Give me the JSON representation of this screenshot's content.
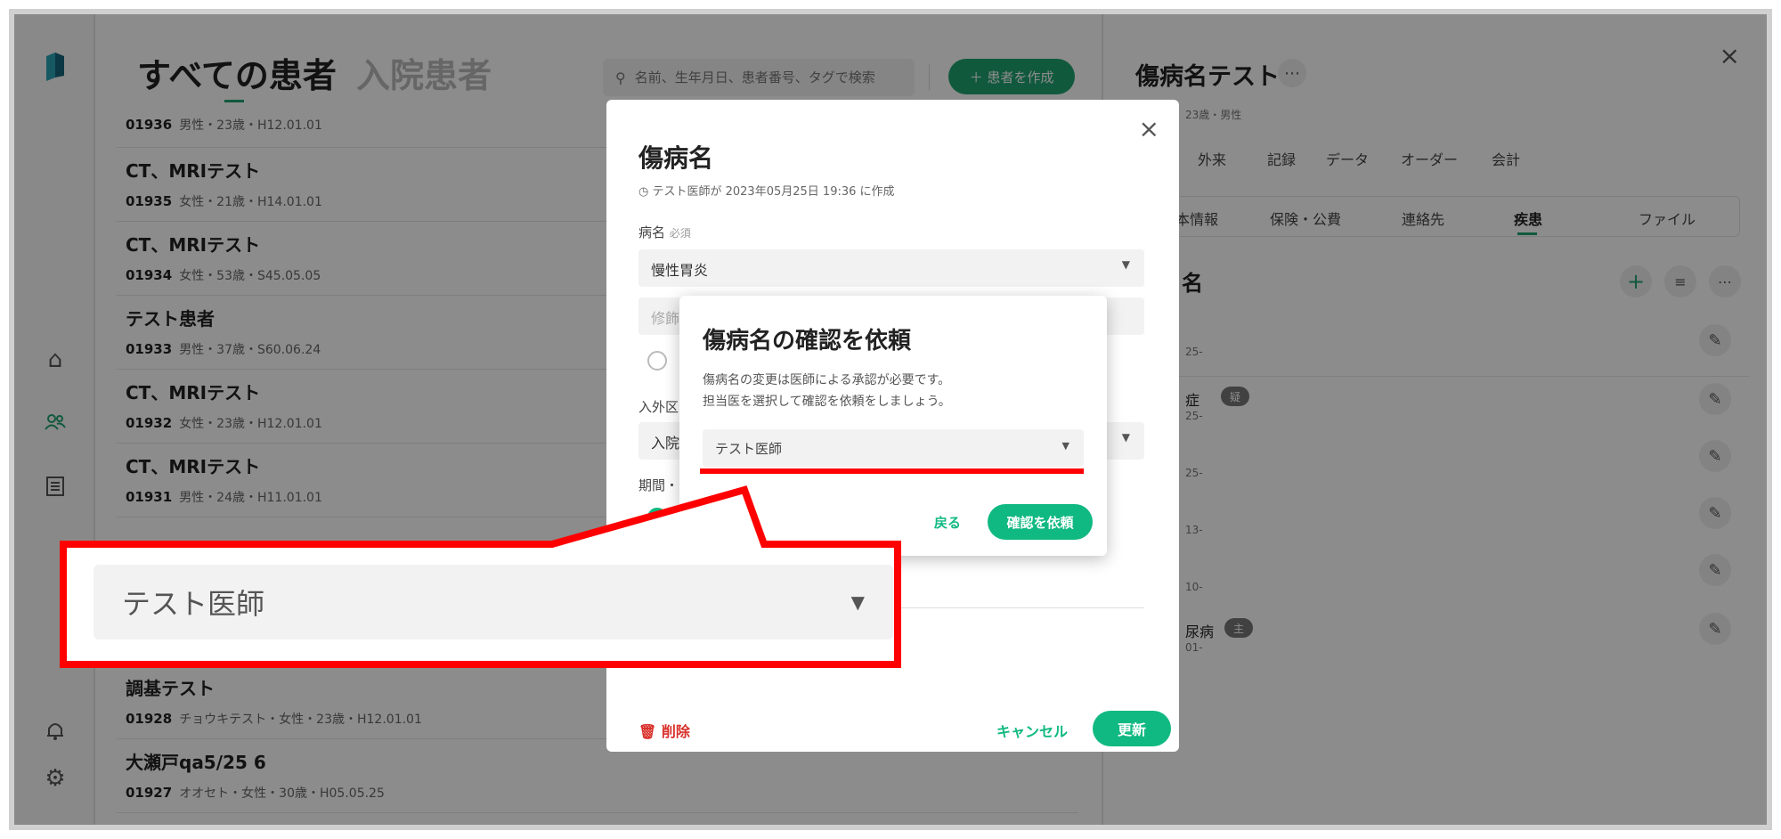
{
  "list": {
    "tabs": [
      "すべての患者",
      "入院患者"
    ],
    "search_placeholder": "名前、生年月日、患者番号、タグで検索",
    "create_button": "＋ 患者を作成",
    "patients": [
      {
        "name": "",
        "id": "01936",
        "meta": "男性・23歳・H12.01.01"
      },
      {
        "name": "CT、MRIテスト",
        "id": "01935",
        "meta": "女性・21歳・H14.01.01"
      },
      {
        "name": "CT、MRIテスト",
        "id": "01934",
        "meta": "女性・53歳・S45.05.05"
      },
      {
        "name": "テスト患者",
        "id": "01933",
        "meta": "男性・37歳・S60.06.24"
      },
      {
        "name": "CT、MRIテスト",
        "id": "01932",
        "meta": "女性・23歳・H12.01.01"
      },
      {
        "name": "CT、MRIテスト",
        "id": "01931",
        "meta": "男性・24歳・H11.01.01"
      },
      {
        "name": "調基テスト",
        "id": "01928",
        "meta": "チョウキテスト・女性・23歳・H12.01.01"
      },
      {
        "name": "大瀬戸qa5/25 6",
        "id": "01927",
        "meta": "オオセト・女性・30歳・H05.05.25"
      }
    ]
  },
  "detail": {
    "title": "傷病名テスト",
    "more_icon": "⋯",
    "subtitle": "23歳・男性",
    "top_tabs": [
      "外来",
      "記録",
      "データ",
      "オーダー",
      "会計"
    ],
    "sub_tabs": [
      "本情報",
      "保険・公費",
      "連絡先",
      "疾患",
      "ファイル"
    ],
    "section_title": "名",
    "rows": [
      {
        "label": "",
        "date": "25-"
      },
      {
        "label": "症",
        "badge": "疑",
        "date": "25-"
      },
      {
        "label": "",
        "date": "25-"
      },
      {
        "label": "",
        "date": "13-"
      },
      {
        "label": "",
        "date": "10-"
      },
      {
        "label": "尿病",
        "badge": "主",
        "date": "01-"
      }
    ],
    "close_icon": "×"
  },
  "modal": {
    "title": "傷病名",
    "created_note": "テスト医師が 2023年05月25日 19:36 に作成",
    "field_label": "病名",
    "required": "必須",
    "disease_value": "慢性胃炎",
    "modifier_placeholder": "修飾",
    "inout_label": "入外区",
    "inout_value": "入院",
    "period_label": "期間・",
    "delete_label": "削除",
    "cancel_label": "キャンセル",
    "update_label": "更新",
    "close_icon": "×"
  },
  "confirm": {
    "title": "傷病名の確認を依頼",
    "line1": "傷病名の変更は医師による承認が必要です。",
    "line2": "担当医を選択して確認を依頼をしましょう。",
    "doctor_value": "テスト医師",
    "back_label": "戻る",
    "submit_label": "確認を依頼"
  },
  "zoom": {
    "doctor_value": "テスト医師"
  },
  "colors": {
    "accent": "#10b981",
    "highlight": "#ff0000"
  }
}
